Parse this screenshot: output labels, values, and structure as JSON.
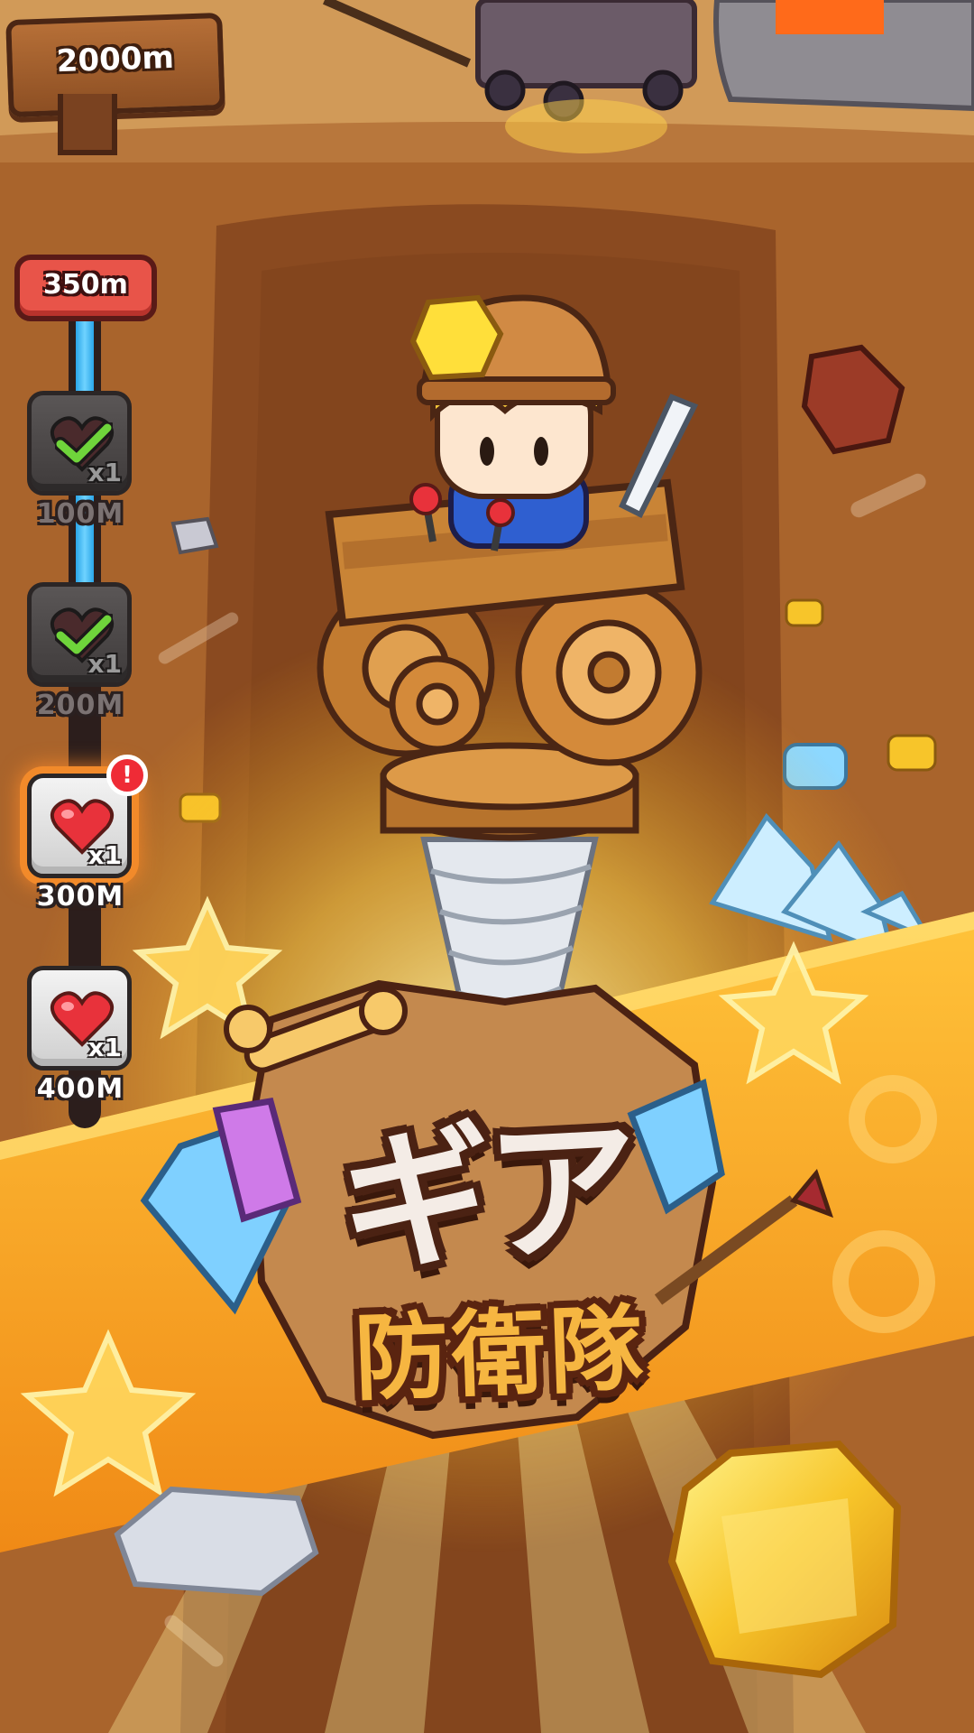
{
  "top_sign": {
    "label": "2000m"
  },
  "depth_badge": {
    "label": "350m",
    "progress": 0.38
  },
  "milestones": [
    {
      "label": "100M",
      "count": "x1",
      "state": "claimed"
    },
    {
      "label": "200M",
      "count": "x1",
      "state": "claimed"
    },
    {
      "label": "300M",
      "count": "x1",
      "state": "available",
      "alert": "!"
    },
    {
      "label": "400M",
      "count": "x1",
      "state": "locked"
    }
  ],
  "title": {
    "main": "ギア",
    "sub": "防衛隊"
  },
  "colors": {
    "banner": "#f5a623",
    "track_fill": "#3fbcf2",
    "heart": "#e8323b",
    "check": "#6fd43b",
    "highlight": "#f28a2a"
  }
}
